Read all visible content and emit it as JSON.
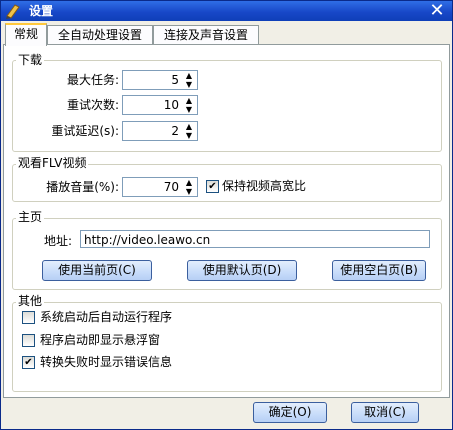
{
  "window": {
    "title": "设置"
  },
  "tabs": [
    "常规",
    "全自动处理设置",
    "连接及声音设置"
  ],
  "download": {
    "legend": "下载",
    "max_tasks_label": "最大任务:",
    "max_tasks_value": "5",
    "retries_label": "重试次数:",
    "retries_value": "10",
    "retry_delay_label": "重试延迟(s):",
    "retry_delay_value": "2"
  },
  "flv": {
    "legend": "观看FLV视频",
    "volume_label": "播放音量(%):",
    "volume_value": "70",
    "keep_ratio_label": "保持视频高宽比",
    "keep_ratio_checked": true
  },
  "homepage": {
    "legend": "主页",
    "address_label": "地址:",
    "address_value": "http://video.leawo.cn",
    "use_current": "使用当前页(C)",
    "use_default": "使用默认页(D)",
    "use_blank": "使用空白页(B)"
  },
  "other": {
    "legend": "其他",
    "options": [
      {
        "label": "系统启动后自动运行程序",
        "checked": false
      },
      {
        "label": "程序启动即显示悬浮窗",
        "checked": false
      },
      {
        "label": "转换失败时显示错误信息",
        "checked": true
      }
    ]
  },
  "footer": {
    "ok": "确定(O)",
    "cancel": "取消(C)"
  },
  "colors": {
    "titlebar": "#1848c8",
    "tab_highlight": "#ffc83c"
  }
}
